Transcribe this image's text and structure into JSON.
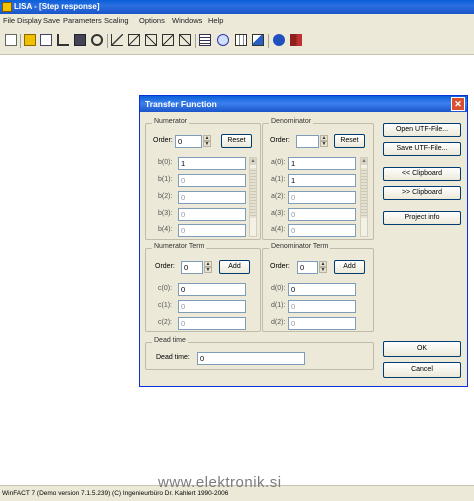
{
  "window": {
    "title": "LISA - [Step response]"
  },
  "menu": [
    "File",
    "Display",
    "Save",
    "Parameters",
    "Scaling",
    "Options",
    "Windows",
    "Help"
  ],
  "toolbar_icons": [
    "new-icon",
    "open-icon",
    "edit-icon",
    "graph-icon",
    "save-icon",
    "binoculars-icon",
    "axis-icon-1",
    "axis-icon-2",
    "axis-icon-3",
    "axis-icon-4",
    "axis-icon-5",
    "tf-icon",
    "zoom-icon",
    "grid-icon",
    "chart-icon",
    "help-icon",
    "exit-icon"
  ],
  "dialog": {
    "title": "Transfer Function",
    "close_glyph": "✕",
    "numerator": {
      "label": "Numerator",
      "order_label": "Order:",
      "order_value": "0",
      "reset_label": "Reset",
      "coef_labels": [
        "b(0):",
        "b(1):",
        "b(2):",
        "b(3):",
        "b(4):"
      ],
      "coef_values": [
        "1",
        "0",
        "0",
        "0",
        "0"
      ]
    },
    "denominator": {
      "label": "Denominator",
      "order_label": "Order:",
      "order_value": "",
      "reset_label": "Reset",
      "coef_labels": [
        "a(0):",
        "a(1):",
        "a(2):",
        "a(3):",
        "a(4):"
      ],
      "coef_values": [
        "1",
        "1",
        "0",
        "0",
        "0"
      ]
    },
    "numerator_term": {
      "label": "Numerator Term",
      "order_label": "Order:",
      "order_value": "0",
      "add_label": "Add",
      "coef_labels": [
        "c(0):",
        "c(1):",
        "c(2):"
      ],
      "coef_values": [
        "0",
        "0",
        "0"
      ]
    },
    "denominator_term": {
      "label": "Denominator Term",
      "order_label": "Order:",
      "order_value": "0",
      "add_label": "Add",
      "coef_labels": [
        "d(0):",
        "d(1):",
        "d(2):"
      ],
      "coef_values": [
        "0",
        "0",
        "0"
      ]
    },
    "dead_time": {
      "label": "Dead time",
      "field_label": "Dead time:",
      "value": "0"
    },
    "buttons": {
      "open": "Open UTF-File...",
      "save": "Save UTF-File...",
      "from_clipboard": "<< Clipboard",
      "to_clipboard": ">> Clipboard",
      "project_info": "Project info",
      "ok": "OK",
      "cancel": "Cancel"
    }
  },
  "statusbar": {
    "text": "WinFACT 7 (Demo version 7.1.5.239) (C) Ingenieurbüro Dr. Kahlert 1990-2006"
  },
  "watermark": "www.elektronik.si"
}
